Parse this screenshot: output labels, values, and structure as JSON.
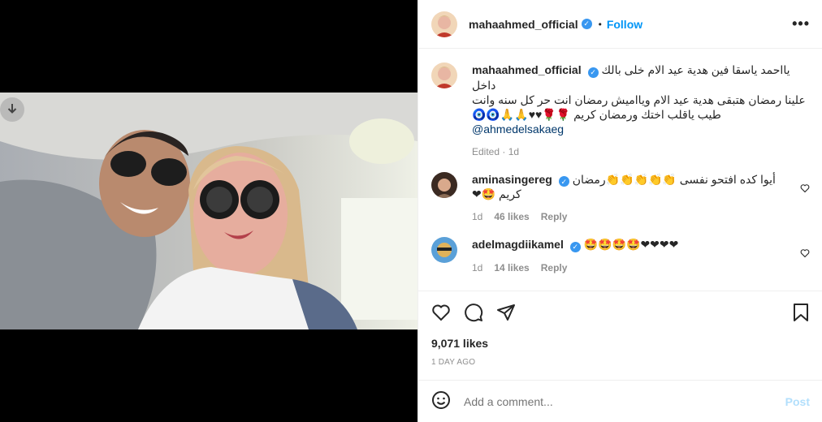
{
  "post": {
    "author": "mahaahmed_official",
    "follow_label": "Follow",
    "more_label": "•••",
    "caption_line1": "يااحمد ياسقا فين هدية عيد الام خلى بالك داخل",
    "caption_line2": "علينا رمضان هتبقى هدية عيد الام ويااميش رمضان انت حر كل سنه وانت",
    "caption_line3": "طيب ياقلب اختك ورمضان كريم 🌹🌹♥♥🙏🙏🧿🧿",
    "caption_mention": "@ahmedelsakaeg",
    "edited_label": "Edited · 1d"
  },
  "comments": [
    {
      "user": "aminasingereg",
      "text_line1": "أيوا كده افتحو نفسى 👏👏👏👏👏رمضان",
      "text_line2": "كريم 🤩❤",
      "time": "1d",
      "likes": "46 likes",
      "reply": "Reply"
    },
    {
      "user": "adelmagdiikamel",
      "text_line1": "🤩🤩🤩🤩❤❤❤❤",
      "time": "1d",
      "likes": "14 likes",
      "reply": "Reply"
    }
  ],
  "stats": {
    "likes": "9,071 likes",
    "date": "1 DAY AGO"
  },
  "composer": {
    "placeholder": "Add a comment...",
    "post_label": "Post"
  },
  "icons": {
    "download": "download-icon",
    "like": "heart-icon",
    "comment": "comment-icon",
    "share": "share-icon",
    "save": "bookmark-icon",
    "emoji": "emoji-icon",
    "verified": "verified-badge-icon"
  },
  "colors": {
    "link_blue": "#0095f6",
    "verified_blue": "#3897f0",
    "muted": "#8e8e8e",
    "border": "#efefef"
  }
}
